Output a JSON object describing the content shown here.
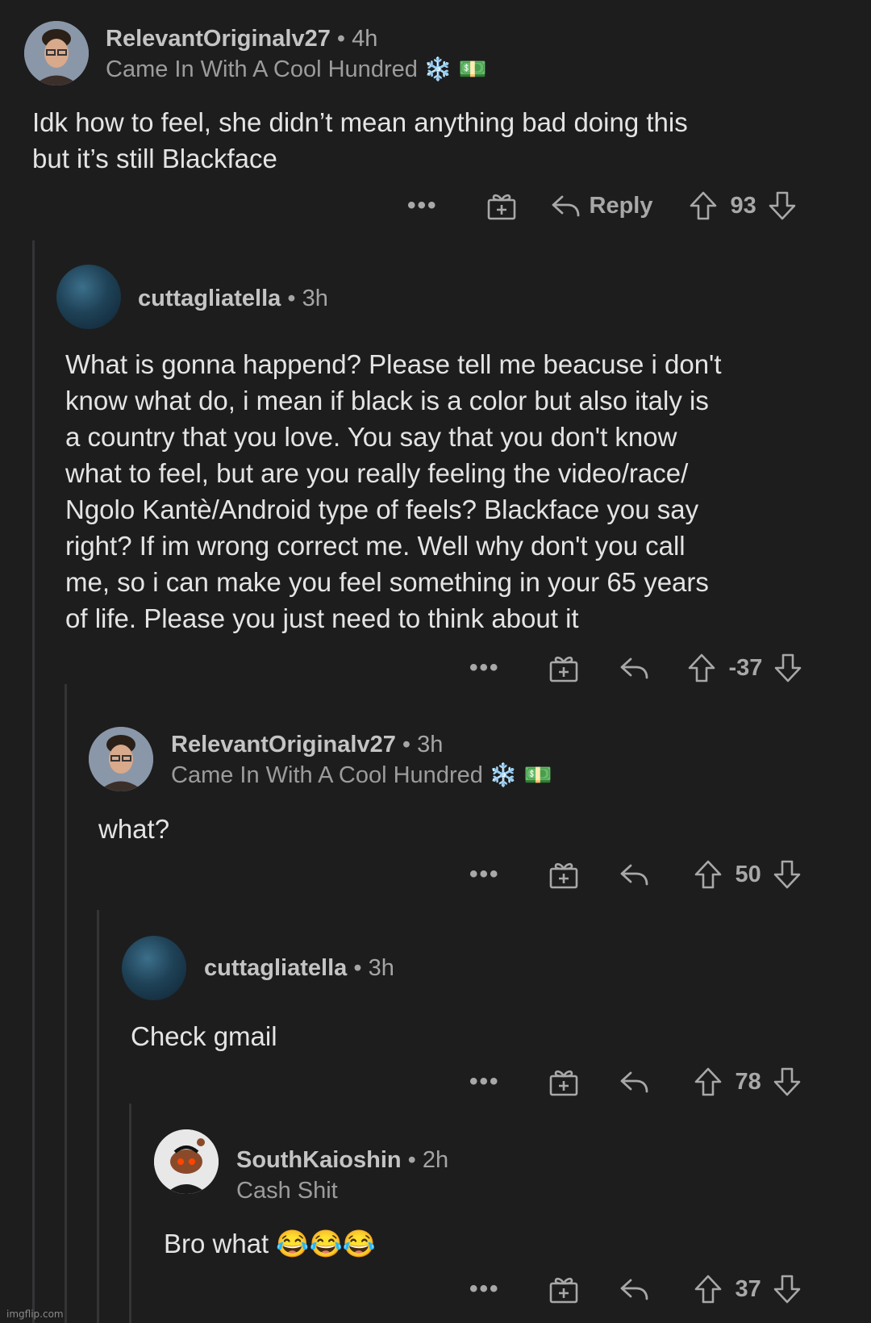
{
  "comments": [
    {
      "username": "RelevantOriginalv27",
      "time": "4h",
      "flair": "Came In With A Cool Hundred",
      "flair_emojis": "❄️ 💵",
      "body": "Idk how to feel, she didn’t mean anything bad doing this\nbut it’s still Blackface",
      "reply_label": "Reply",
      "score": "93"
    },
    {
      "username": "cuttagliatella",
      "time": "3h",
      "body": "What is gonna happend? Please tell me beacuse i don't\nknow what do, i mean if black is a color but also italy is\na country that you love. You say that you don't know\nwhat to feel, but are you really feeling the video/race/\nNgolo Kantè/Android type of feels? Blackface you say\nright? If im wrong correct me. Well why don't you call\nme, so i can make you feel something in your 65 years\nof life. Please you just need to think about it",
      "score": "-37"
    },
    {
      "username": "RelevantOriginalv27",
      "time": "3h",
      "flair": "Came In With A Cool Hundred",
      "flair_emojis": "❄️ 💵",
      "body": "what?",
      "score": "50"
    },
    {
      "username": "cuttagliatella",
      "time": "3h",
      "body": "Check gmail",
      "score": "78"
    },
    {
      "username": "SouthKaioshin",
      "time": "2h",
      "flair": "Cash Shit",
      "body": "Bro what 😂😂😂",
      "score": "37"
    }
  ],
  "separator": "•",
  "more_label": "•••",
  "watermark": "imgflip.com",
  "colors": {
    "background": "#1d1d1e",
    "text": "#e4e4e4",
    "muted": "#a8a8a8",
    "thread_line": "#343436"
  }
}
